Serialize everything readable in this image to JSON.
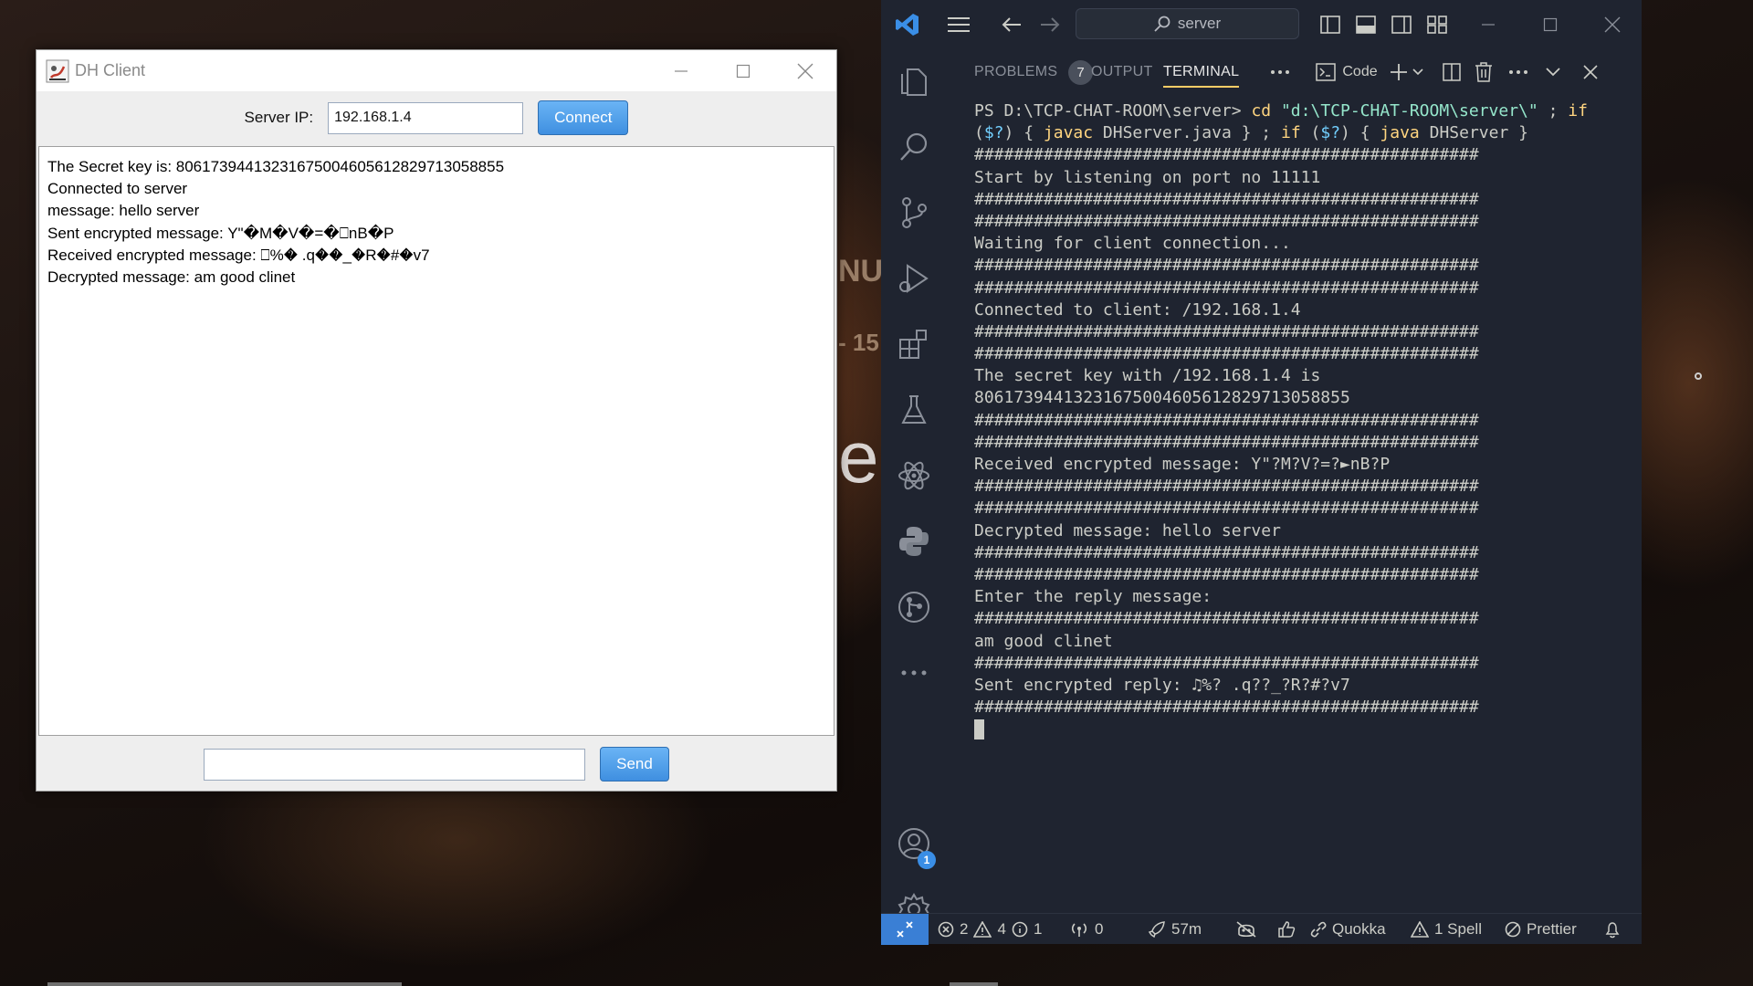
{
  "dh_client": {
    "title": "DH Client",
    "server_ip_label": "Server IP:",
    "server_ip_value": "192.168.1.4",
    "connect_label": "Connect",
    "log_lines": [
      "The Secret key is: 80617394413231675004605612829713058855",
      "Connected to server",
      "message: hello server",
      "Sent encrypted message: Y\"�M�V�=�⎕nB�P",
      "Received encrypted message: ⎕%� .q��_�R�#�v7",
      "Decrypted message: am good clinet"
    ],
    "message_value": "",
    "send_label": "Send"
  },
  "vscode": {
    "search_text": "server",
    "tabs": {
      "problems": "PROBLEMS",
      "problems_count": "7",
      "output": "OUTPUT",
      "terminal": "TERMINAL",
      "shell_label": "Code"
    },
    "accounts_badge": "1",
    "terminal": {
      "prompt": "PS D:\\TCP-CHAT-ROOM\\server> ",
      "cmd_cd": "cd",
      "cmd_path": "\"d:\\TCP-CHAT-ROOM\\server\\\"",
      "cmd_semicolon": " ; ",
      "cmd_if": "if",
      "line2_open": "(",
      "line2_var": "$?",
      "line2_mid": ") { ",
      "line2_javac": "javac",
      "line2_file": " DHServer.java } ; ",
      "line2_if": "if",
      "line2_open2": " (",
      "line2_var2": "$?",
      "line2_mid2": ") { ",
      "line2_java": "java",
      "line2_end": " DHServer }",
      "lines": [
        "###################################################",
        "Start by listening on port no 11111",
        "###################################################",
        "###################################################",
        "Waiting for client connection...",
        "###################################################",
        "###################################################",
        "Connected to client: /192.168.1.4",
        "###################################################",
        "###################################################",
        "The secret key with /192.168.1.4 is",
        "80617394413231675004605612829713058855",
        "###################################################",
        "###################################################",
        "Received encrypted message: Y\"?M?V?=?►nB?P",
        "###################################################",
        "###################################################",
        "Decrypted message: hello server",
        "###################################################",
        "###################################################",
        "Enter the reply message:",
        "###################################################",
        "am good clinet",
        "###################################################",
        "Sent encrypted reply: ♫%? .q??_?R?#?v7",
        "###################################################"
      ]
    },
    "status": {
      "errors": "2",
      "warnings": "4",
      "infos": "1",
      "ports": "0",
      "time": "57m",
      "quokka": "Quokka",
      "spell": "1 Spell",
      "prettier": "Prettier"
    }
  },
  "wallpaper_text": {
    "fragment_1": "NU",
    "fragment_2": "- 15",
    "fragment_3": "e"
  },
  "colors": {
    "accent_blue": "#3a7fd5",
    "tab_underline": "#ffcc66",
    "editor_bg": "#1f2430"
  }
}
